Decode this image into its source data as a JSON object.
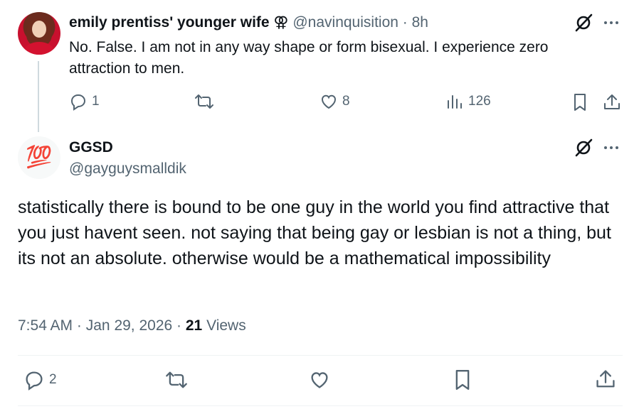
{
  "reply_tweet": {
    "author_name": "emily prentiss' younger wife",
    "author_symbol": "⚢",
    "handle": "@navinquisition",
    "separator": "·",
    "time": "8h",
    "body": "No. False. I am not in any way shape or form bisexual. I experience zero attraction to men.",
    "actions": {
      "replies": "1",
      "reposts": "",
      "likes": "8",
      "views": "126"
    }
  },
  "main_tweet": {
    "author_name": "GGSD",
    "avatar_emoji": "💯",
    "handle": "@gayguysmalldik",
    "body": "statistically there is bound to be one guy in the world you find attractive that you just havent seen. not saying that being gay or lesbian is not a thing, but its not an absolute. otherwise would be a mathematical impossibility",
    "meta": {
      "time": "7:54 AM",
      "separator1": "·",
      "date": "Jan 29, 2026",
      "separator2": "·",
      "views_count": "21",
      "views_label": "Views"
    },
    "actions": {
      "replies": "2"
    }
  },
  "icons": {
    "reply": "reply-icon",
    "repost": "repost-icon",
    "like": "like-icon",
    "views": "views-icon",
    "bookmark": "bookmark-icon",
    "share": "share-icon",
    "grok": "grok-icon",
    "more": "more-icon"
  },
  "colors": {
    "text_primary": "#0f1419",
    "text_secondary": "#536471",
    "divider": "#eff3f4",
    "thread_line": "#cfd9de"
  }
}
